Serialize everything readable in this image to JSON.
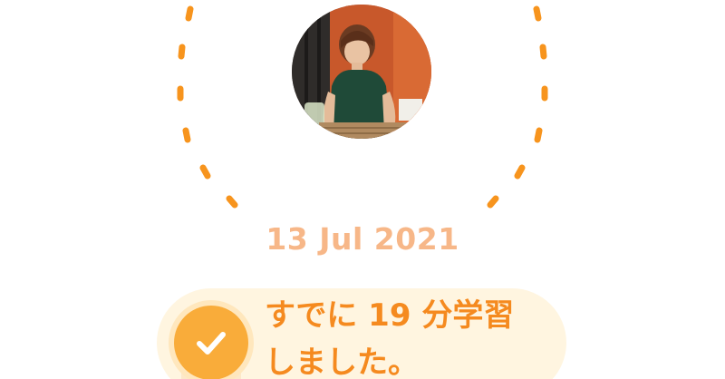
{
  "date_label": "13 Jul 2021",
  "message": {
    "line1": "すでに 19 分学習",
    "line2": "しました。"
  },
  "icons": {
    "avatar": "profile-photo",
    "status": "checkmark-icon"
  },
  "colors": {
    "accent_orange": "#f7941d",
    "date_text": "#f7b788",
    "message_text": "#f58a1f",
    "check_circle": "#f9ac3a",
    "banner_bg": "#fff5e0"
  }
}
